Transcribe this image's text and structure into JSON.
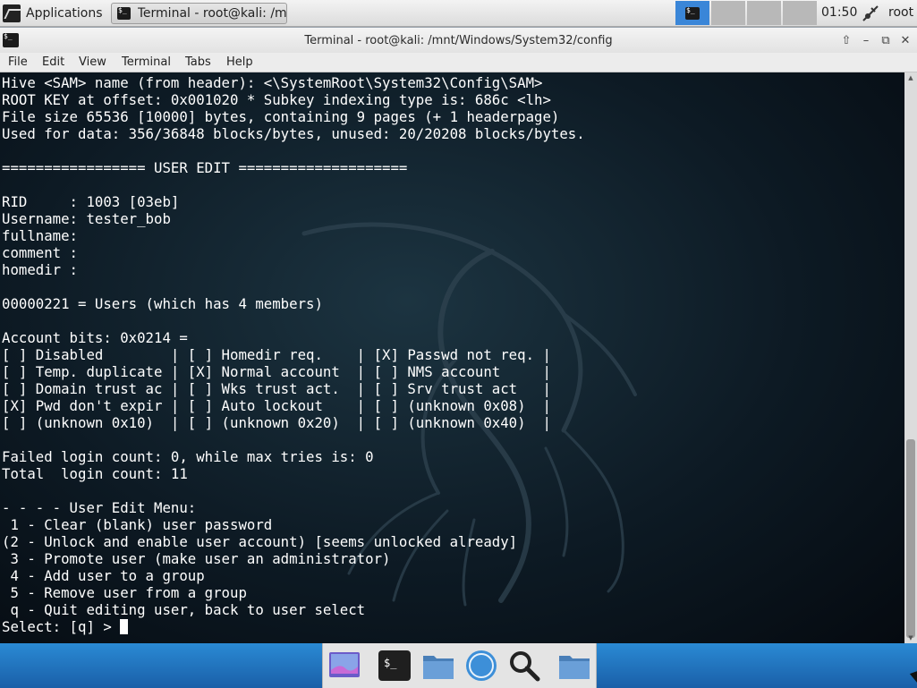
{
  "top_panel": {
    "applications_label": "Applications",
    "task_label": "Terminal - root@kali: /m...",
    "clock": "01:50",
    "user": "root"
  },
  "window": {
    "title": "Terminal - root@kali: /mnt/Windows/System32/config",
    "menu": [
      "File",
      "Edit",
      "View",
      "Terminal",
      "Tabs",
      "Help"
    ]
  },
  "terminal": {
    "lines": [
      "Hive <SAM> name (from header): <\\SystemRoot\\System32\\Config\\SAM>",
      "ROOT KEY at offset: 0x001020 * Subkey indexing type is: 686c <lh>",
      "File size 65536 [10000] bytes, containing 9 pages (+ 1 headerpage)",
      "Used for data: 356/36848 blocks/bytes, unused: 20/20208 blocks/bytes.",
      "",
      "================= USER EDIT ====================",
      "",
      "RID     : 1003 [03eb]",
      "Username: tester_bob",
      "fullname:",
      "comment :",
      "homedir :",
      "",
      "00000221 = Users (which has 4 members)",
      "",
      "Account bits: 0x0214 =",
      "[ ] Disabled        | [ ] Homedir req.    | [X] Passwd not req. |",
      "[ ] Temp. duplicate | [X] Normal account  | [ ] NMS account     |",
      "[ ] Domain trust ac | [ ] Wks trust act.  | [ ] Srv trust act   |",
      "[X] Pwd don't expir | [ ] Auto lockout    | [ ] (unknown 0x08)  |",
      "[ ] (unknown 0x10)  | [ ] (unknown 0x20)  | [ ] (unknown 0x40)  |",
      "",
      "Failed login count: 0, while max tries is: 0",
      "Total  login count: 11",
      "",
      "- - - - User Edit Menu:",
      " 1 - Clear (blank) user password",
      "(2 - Unlock and enable user account) [seems unlocked already]",
      " 3 - Promote user (make user an administrator)",
      " 4 - Add user to a group",
      " 5 - Remove user from a group",
      " q - Quit editing user, back to user select"
    ],
    "prompt": "Select: [q] > "
  },
  "colors": {
    "terminal_text": "#ffffff",
    "active_workspace": "#3a86d8",
    "desktop_blue": "#1a6fc0"
  },
  "dock_icons": [
    "desktop-icon",
    "terminal-icon",
    "file-manager-icon",
    "web-browser-icon",
    "search-icon",
    "folder-icon"
  ]
}
